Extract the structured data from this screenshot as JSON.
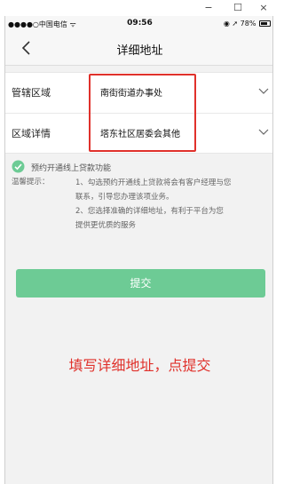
{
  "window": {
    "minimize_glyph": "−",
    "maximize_glyph": "☐",
    "close_glyph": "×"
  },
  "status_bar": {
    "carrier": "●●●●○中国电信 ᯤ",
    "time": "09:56",
    "right": "◉ ➚ 78%",
    "battery_level": 0.78
  },
  "nav": {
    "back_icon": "chevron-left-icon",
    "title": "详细地址"
  },
  "form": {
    "rows": [
      {
        "label": "管辖区域",
        "value": "南街街道办事处"
      },
      {
        "label": "区域详情",
        "value": "塔东社区居委会其他"
      }
    ]
  },
  "agreement": {
    "checked": true,
    "label": "预约开通线上贷款功能"
  },
  "tips": {
    "label": "温馨提示：",
    "lines": [
      "1、勾选预约开通线上贷款将会有客户经理与您",
      "联系，引导您办理该项业务。",
      "2、您选择准确的详细地址，有利于平台为您",
      "提供更优质的服务"
    ]
  },
  "submit": {
    "label": "提交"
  },
  "annotation": {
    "text": "填写详细地址，点提交"
  },
  "colors": {
    "accent_green": "#6dcb95",
    "highlight_red": "#e0312b",
    "page_background": "#f2f2f2"
  }
}
